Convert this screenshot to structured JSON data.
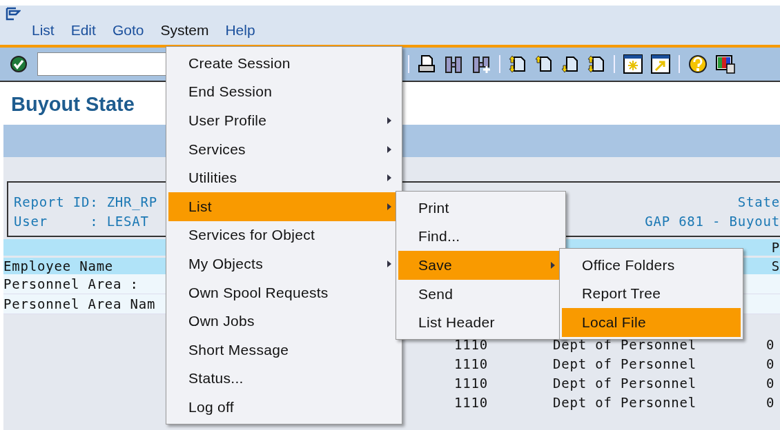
{
  "menu_bar": [
    {
      "label": "List",
      "selected": false
    },
    {
      "label": "Edit",
      "selected": false
    },
    {
      "label": "Goto",
      "selected": false
    },
    {
      "label": "System",
      "selected": true
    },
    {
      "label": "Help",
      "selected": false
    }
  ],
  "title": "Buyout State",
  "report_header": {
    "left": [
      "Report ID: ZHR_RP",
      "User     : LESAT"
    ],
    "right": [
      "State",
      "GAP 681 - Buyout"
    ]
  },
  "list": {
    "header_rows": [
      {
        "right": "P"
      },
      {
        "left": "Employee Name",
        "right": "S"
      }
    ],
    "info_rows": [
      "Personnel Area :",
      "Personnel Area Nam"
    ],
    "data_rows": [
      {
        "area": "1110",
        "text": "Dept of Personnel",
        "last": "0"
      },
      {
        "area": "1110",
        "text": "Dept of Personnel",
        "last": "0"
      },
      {
        "area": "1110",
        "text": "Dept of Personnel",
        "last": "0"
      },
      {
        "area": "1110",
        "text": "Dept of Personnel",
        "last": "0"
      }
    ]
  },
  "menus": [
    {
      "items": [
        {
          "label": "Create Session",
          "submenu": false,
          "selected": false
        },
        {
          "label": "End Session",
          "submenu": false,
          "selected": false
        },
        {
          "label": "User Profile",
          "submenu": true,
          "selected": false
        },
        {
          "label": "Services",
          "submenu": true,
          "selected": false
        },
        {
          "label": "Utilities",
          "submenu": true,
          "selected": false
        },
        {
          "label": "List",
          "submenu": true,
          "selected": true
        },
        {
          "label": "Services for Object",
          "submenu": false,
          "selected": false
        },
        {
          "label": "My Objects",
          "submenu": true,
          "selected": false
        },
        {
          "label": "Own Spool Requests",
          "submenu": false,
          "selected": false
        },
        {
          "label": "Own Jobs",
          "submenu": false,
          "selected": false
        },
        {
          "label": "Short Message",
          "submenu": false,
          "selected": false
        },
        {
          "label": "Status...",
          "submenu": false,
          "selected": false
        },
        {
          "label": "Log off",
          "submenu": false,
          "selected": false
        }
      ]
    },
    {
      "items": [
        {
          "label": "Print",
          "submenu": false,
          "selected": false
        },
        {
          "label": "Find...",
          "submenu": false,
          "selected": false
        },
        {
          "label": "Save",
          "submenu": true,
          "selected": true
        },
        {
          "label": "Send",
          "submenu": false,
          "selected": false
        },
        {
          "label": "List Header",
          "submenu": false,
          "selected": false
        }
      ]
    },
    {
      "items": [
        {
          "label": "Office Folders",
          "submenu": false,
          "selected": false
        },
        {
          "label": "Report Tree",
          "submenu": false,
          "selected": false
        },
        {
          "label": "Local File",
          "submenu": false,
          "selected": true
        }
      ]
    }
  ]
}
